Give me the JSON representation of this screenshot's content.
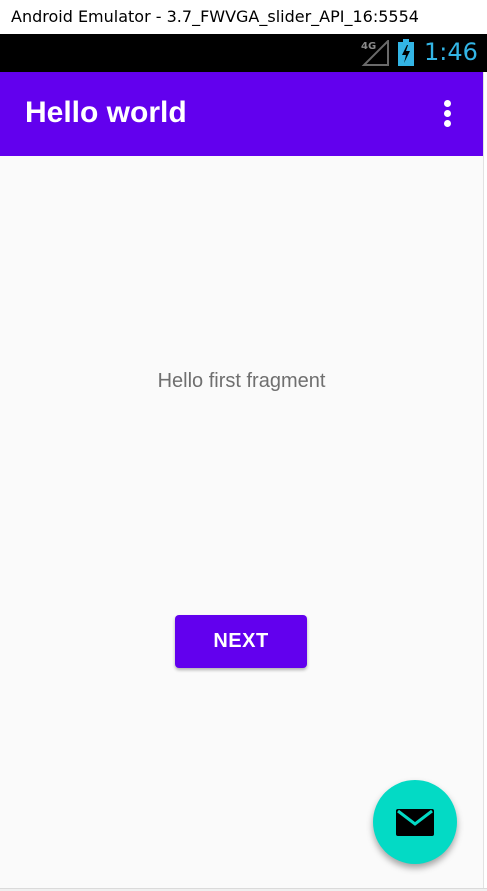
{
  "window": {
    "title": "Android Emulator - 3.7_FWVGA_slider_API_16:5554"
  },
  "statusbar": {
    "network_label": "4G",
    "time": "1:46",
    "signal_icon": "signal-4g-icon",
    "battery_icon": "battery-charging-icon"
  },
  "appbar": {
    "title": "Hello world",
    "overflow_icon": "more-vert-icon"
  },
  "content": {
    "fragment_text": "Hello first fragment",
    "next_label": "NEXT"
  },
  "fab": {
    "icon": "email-icon"
  },
  "colors": {
    "primary": "#6200ee",
    "accent": "#03dac5",
    "clock": "#33b5e5",
    "background": "#fafafa"
  }
}
